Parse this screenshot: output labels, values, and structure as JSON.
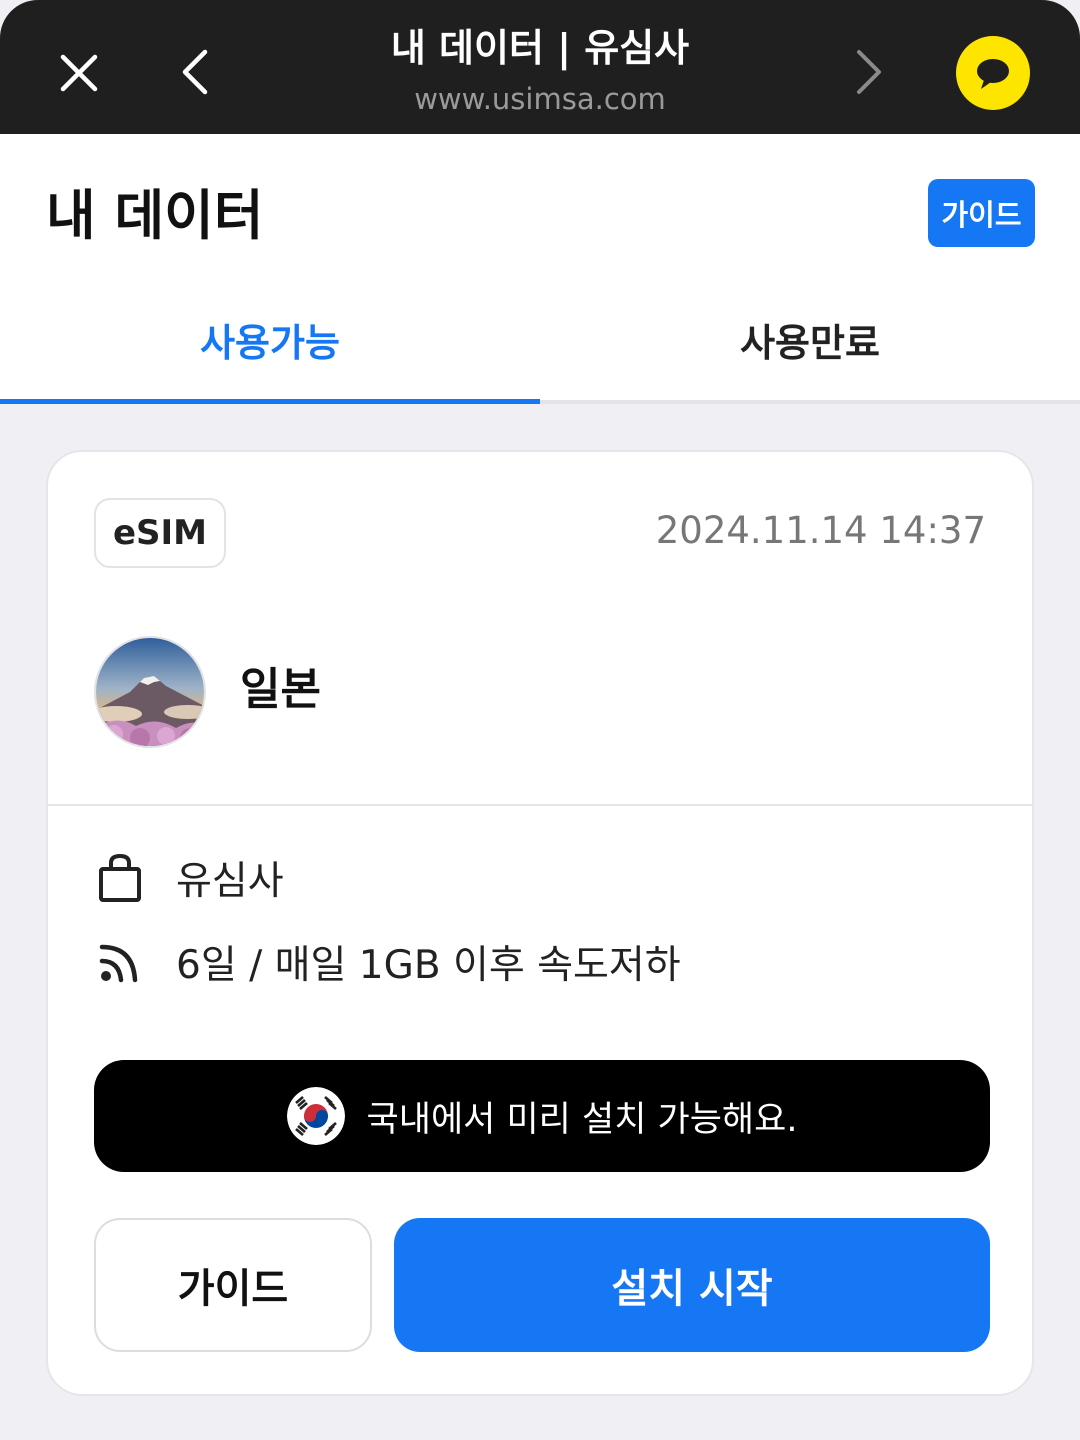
{
  "browser": {
    "title": "내 데이터 | 유심사",
    "url": "www.usimsa.com",
    "icons": {
      "close": "close-icon",
      "back": "chevron-left-icon",
      "forward": "chevron-right-icon",
      "talk": "kakaotalk-icon"
    },
    "talk_color": "#fee500"
  },
  "header": {
    "title": "내 데이터",
    "guide_label": "가이드"
  },
  "tabs": [
    {
      "label": "사용가능",
      "active": true
    },
    {
      "label": "사용만료",
      "active": false
    }
  ],
  "card": {
    "type_badge": "eSIM",
    "date": "2024.11.14 14:37",
    "country": "일본",
    "seller": "유심사",
    "plan": "6일 / 매일 1GB 이후 속도저하",
    "notice": "국내에서 미리 설치 가능해요.",
    "guide_button": "가이드",
    "install_button": "설치 시작"
  },
  "colors": {
    "accent": "#1677f4",
    "topbar": "#1f1f1f",
    "background": "#efeff4"
  }
}
